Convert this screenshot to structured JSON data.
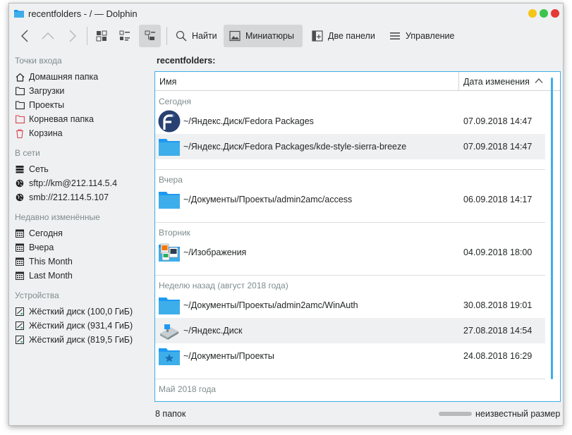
{
  "window": {
    "title": "recentfolders - / — Dolphin",
    "controls": {
      "minimize_color": "#f5c518",
      "maximize_color": "#3bc44b",
      "close_color": "#e53935"
    }
  },
  "toolbar": {
    "back_icon": "arrow-left-icon",
    "up_icon": "arrow-up-icon",
    "forward_icon": "arrow-right-icon",
    "view_icons": "icons-view-icon",
    "view_compact": "compact-view-icon",
    "view_details": "details-view-icon",
    "find_label": "Найти",
    "preview_label": "Миниатюры",
    "split_label": "Две панели",
    "menu_label": "Управление"
  },
  "sidebar": {
    "places_header": "Точки входа",
    "places": [
      {
        "label": "Домашняя папка",
        "icon": "home-icon"
      },
      {
        "label": "Загрузки",
        "icon": "folder-icon"
      },
      {
        "label": "Проекты",
        "icon": "folder-icon"
      },
      {
        "label": "Корневая папка",
        "icon": "folder-red-icon"
      },
      {
        "label": "Корзина",
        "icon": "trash-icon"
      }
    ],
    "network_header": "В сети",
    "network": [
      {
        "label": "Сеть",
        "icon": "network-icon"
      },
      {
        "label": "sftp://km@212.114.5.4",
        "icon": "globe-icon"
      },
      {
        "label": "smb://212.114.5.107",
        "icon": "globe-icon"
      }
    ],
    "recent_header": "Недавно изменённые",
    "recent": [
      {
        "label": "Сегодня",
        "icon": "calendar-icon"
      },
      {
        "label": "Вчера",
        "icon": "calendar-icon"
      },
      {
        "label": "This Month",
        "icon": "calendar-icon"
      },
      {
        "label": "Last Month",
        "icon": "calendar-icon"
      }
    ],
    "devices_header": "Устройства",
    "devices": [
      {
        "label": "Жёсткий диск (100,0 ГиБ)",
        "icon": "drive-icon"
      },
      {
        "label": "Жёсткий диск (931,4 ГиБ)",
        "icon": "drive-icon"
      },
      {
        "label": "Жёсткий диск (819,5 ГиБ)",
        "icon": "drive-icon"
      }
    ]
  },
  "location": "recentfolders:",
  "columns": {
    "name": "Имя",
    "date": "Дата изменения"
  },
  "groups": [
    {
      "label": "Сегодня",
      "items": [
        {
          "name": "~/Яндекс.Диск/Fedora Packages",
          "date": "07.09.2018 14:47",
          "icon": "fedora-icon"
        },
        {
          "name": "~/Яндекс.Диск/Fedora Packages/kde-style-sierra-breeze",
          "date": "07.09.2018 14:47",
          "icon": "folder-icon"
        }
      ]
    },
    {
      "label": "Вчера",
      "items": [
        {
          "name": "~/Документы/Проекты/admin2amc/access",
          "date": "06.09.2018 14:17",
          "icon": "folder-icon"
        }
      ]
    },
    {
      "label": "Вторник",
      "items": [
        {
          "name": "~/Изображения",
          "date": "04.09.2018 18:00",
          "icon": "pictures-folder-icon"
        }
      ]
    },
    {
      "label": "Неделю назад (август 2018 года)",
      "items": [
        {
          "name": "~/Документы/Проекты/admin2amc/WinAuth",
          "date": "30.08.2018 19:01",
          "icon": "folder-icon"
        },
        {
          "name": "~/Яндекс.Диск",
          "date": "27.08.2018 14:54",
          "icon": "yandex-disk-icon"
        },
        {
          "name": "~/Документы/Проекты",
          "date": "24.08.2018 16:29",
          "icon": "folder-favorite-icon"
        }
      ]
    },
    {
      "label": "Май 2018 года",
      "items": []
    }
  ],
  "status": {
    "left": "8 папок",
    "right": "неизвестный размер"
  }
}
